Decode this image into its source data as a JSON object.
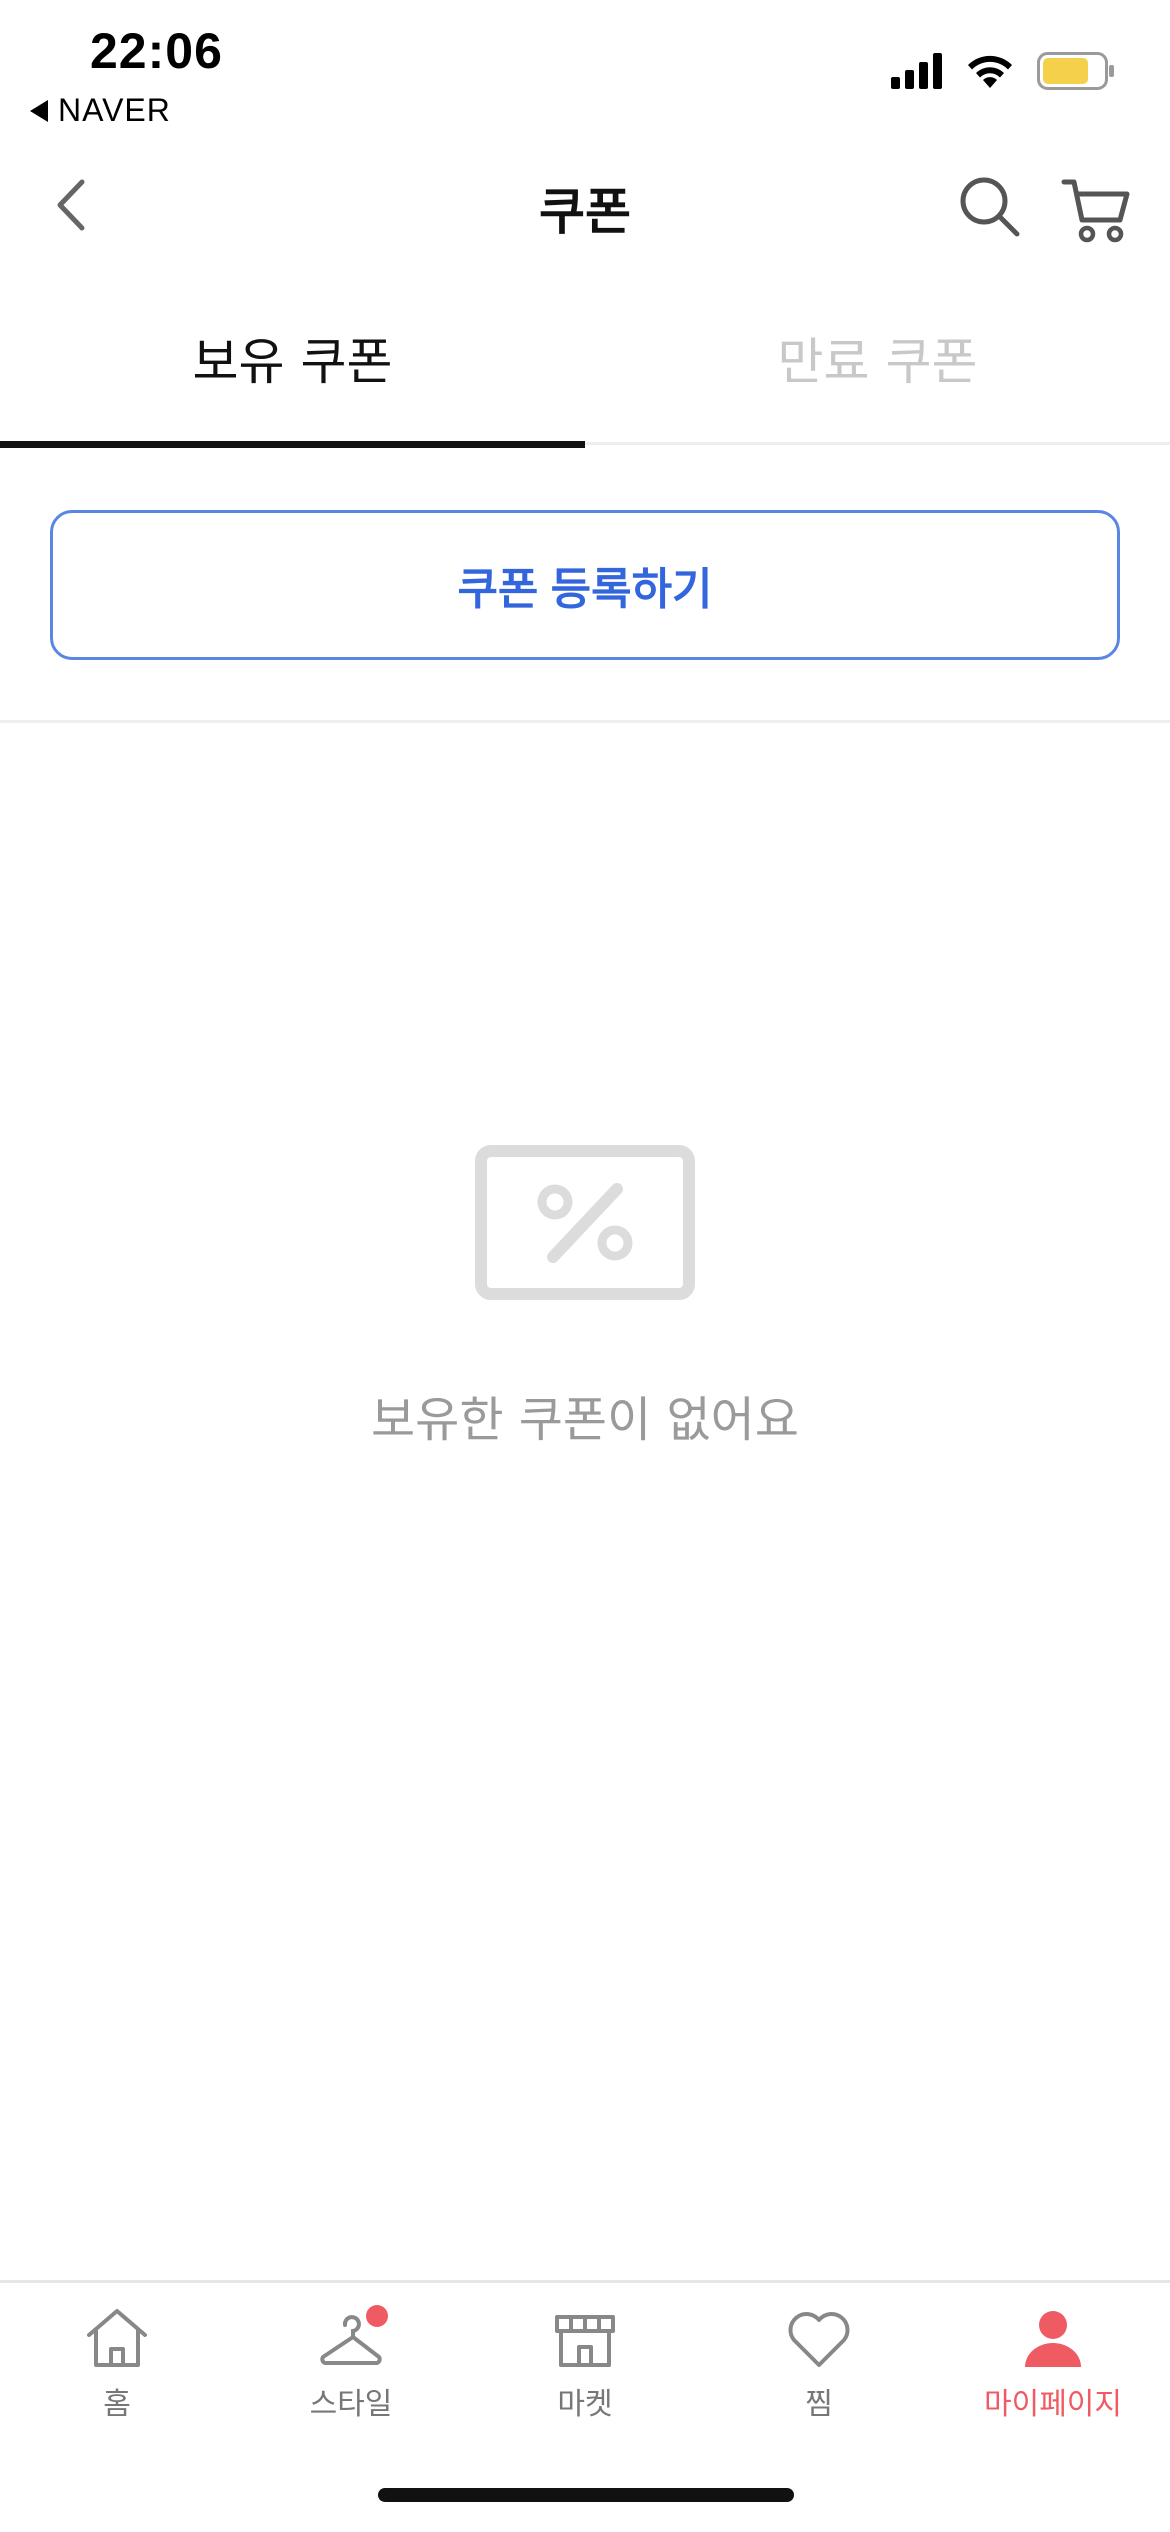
{
  "status_bar": {
    "time": "22:06",
    "back_app": "NAVER"
  },
  "header": {
    "title": "쿠폰"
  },
  "tabs": [
    {
      "label": "보유 쿠폰",
      "active": true
    },
    {
      "label": "만료 쿠폰",
      "active": false
    }
  ],
  "register_button": {
    "label": "쿠폰 등록하기"
  },
  "empty_state": {
    "message": "보유한 쿠폰이 없어요",
    "icon": "coupon-percent-icon"
  },
  "bottom_nav": [
    {
      "label": "홈",
      "icon": "home-icon",
      "active": false
    },
    {
      "label": "스타일",
      "icon": "hanger-icon",
      "active": false,
      "badge": true
    },
    {
      "label": "마켓",
      "icon": "store-icon",
      "active": false
    },
    {
      "label": "찜",
      "icon": "heart-icon",
      "active": false
    },
    {
      "label": "마이페이지",
      "icon": "person-icon",
      "active": true
    }
  ],
  "colors": {
    "accent_blue": "#3366dd",
    "active_red": "#ef5b63",
    "battery_yellow": "#f5d04a",
    "muted_text": "#9a9a9a"
  }
}
